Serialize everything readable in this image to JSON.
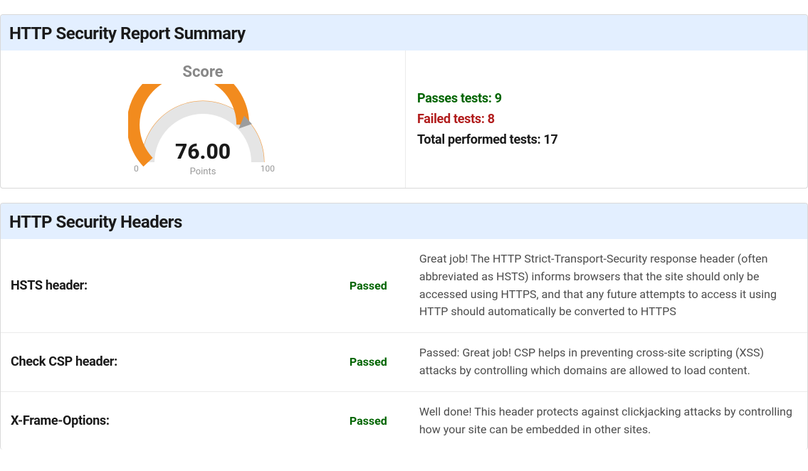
{
  "summary": {
    "title": "HTTP Security Report Summary",
    "score_title": "Score",
    "score_value": "76.00",
    "score_unit": "Points",
    "score_min": "0",
    "score_max": "100",
    "passes_label": "Passes tests: 9",
    "failed_label": "Failed tests: 8",
    "total_label": "Total performed tests: 17"
  },
  "chart_data": {
    "type": "gauge",
    "value": 76.0,
    "min": 0,
    "max": 100,
    "title": "Score",
    "unit": "Points"
  },
  "headers": {
    "title": "HTTP Security Headers",
    "rows": [
      {
        "name": "HSTS header:",
        "status": "Passed",
        "status_class": "status-pass",
        "desc": "Great job! The HTTP Strict-Transport-Security response header (often abbreviated as HSTS) informs browsers that the site should only be accessed using HTTPS, and that any future attempts to access it using HTTP should automatically be converted to HTTPS"
      },
      {
        "name": "Check CSP header:",
        "status": "Passed",
        "status_class": "status-pass",
        "desc": "Passed: Great job! CSP helps in preventing cross-site scripting (XSS) attacks by controlling which domains are allowed to load content."
      },
      {
        "name": "X-Frame-Options:",
        "status": "Passed",
        "status_class": "status-pass",
        "desc": "Well done! This header protects against clickjacking attacks by controlling how your site can be embedded in other sites."
      }
    ]
  }
}
